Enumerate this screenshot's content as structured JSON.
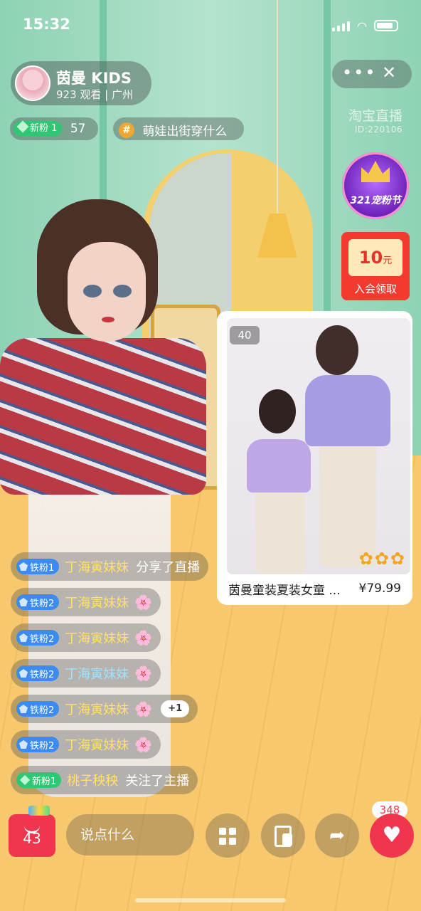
{
  "status_bar": {
    "time": "15:32"
  },
  "host": {
    "name": "茵曼 KIDS",
    "meta": "923 观看 | 广州"
  },
  "top_right": {
    "more": "•••",
    "close": "✕"
  },
  "brand": {
    "name": "淘宝直播",
    "id": "ID:220106"
  },
  "chips": {
    "fan_badge": "新粉 1",
    "fan_count": "57",
    "topic_symbol": "#",
    "topic": "萌娃出街穿什么"
  },
  "promos": {
    "festival": "321宠粉节",
    "coupon_amount": "10",
    "coupon_unit": "元",
    "coupon_label": "入会领取"
  },
  "product": {
    "count": "40",
    "title": "茵曼童装夏装女童 ...",
    "price": "¥79.99"
  },
  "comments": [
    {
      "tier": "铁粉1",
      "user": "丁海寅妹妹",
      "text": "分享了直播",
      "flower": "",
      "extra": ""
    },
    {
      "tier": "铁粉2",
      "user": "丁海寅妹妹",
      "text": "",
      "flower": "🌸",
      "extra": ""
    },
    {
      "tier": "铁粉2",
      "user": "丁海寅妹妹",
      "text": "",
      "flower": "🌸",
      "extra": ""
    },
    {
      "tier": "铁粉2",
      "user": "丁海寅妹妹",
      "text": "",
      "flower": "🌸",
      "extra": ""
    },
    {
      "tier": "铁粉2",
      "user": "丁海寅妹妹",
      "text": "",
      "flower": "🌸",
      "extra": "+1"
    },
    {
      "tier": "铁粉2",
      "user": "丁海寅妹妹",
      "text": "",
      "flower": "🌸",
      "extra": ""
    },
    {
      "tier": "新粉1",
      "user": "桃子秧秧",
      "text": "关注了主播",
      "flower": "",
      "extra": ""
    }
  ],
  "bottom_bar": {
    "cart_count": "43",
    "input_placeholder": "说点什么",
    "like_count": "348"
  },
  "colors": {
    "accent_red": "#f0364f",
    "fan_green": "#2fc773",
    "tier_blue": "#3b8bf0"
  }
}
